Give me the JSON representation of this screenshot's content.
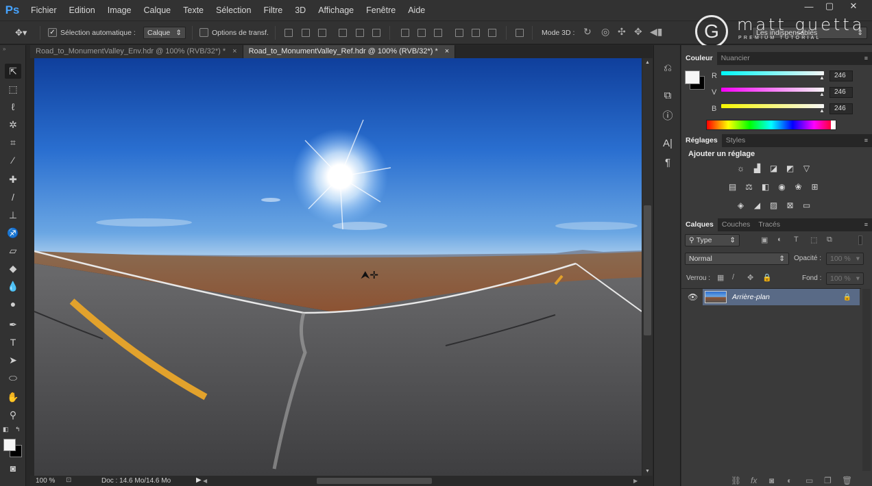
{
  "app_logo": "Ps",
  "menu": [
    "Fichier",
    "Edition",
    "Image",
    "Calque",
    "Texte",
    "Sélection",
    "Filtre",
    "3D",
    "Affichage",
    "Fenêtre",
    "Aide"
  ],
  "window_controls": {
    "minimize": "—",
    "restore": "▢",
    "close": "✕"
  },
  "watermark": {
    "title": "matt guetta",
    "subtitle": "PREMIUM TUTORIAL"
  },
  "options": {
    "auto_select_label": "Sélection automatique :",
    "auto_select_checked": true,
    "auto_select_value": "Calque",
    "transform_label": "Options de transf.",
    "mode3d_label": "Mode 3D :",
    "workspace": "Les indispensables"
  },
  "tabs": [
    {
      "label": "Road_to_MonumentValley_Env.hdr @ 100% (RVB/32*) *",
      "close": "×"
    },
    {
      "label": "Road_to_MonumentValley_Ref.hdr @ 100% (RVB/32*) *",
      "close": "×"
    }
  ],
  "status": {
    "zoom": "100 %",
    "doc": "Doc : 14.6 Mo/14.6 Mo"
  },
  "color_panel": {
    "tabs": [
      "Couleur",
      "Nuancier"
    ],
    "channels": [
      {
        "label": "R",
        "value": "246"
      },
      {
        "label": "V",
        "value": "246"
      },
      {
        "label": "B",
        "value": "246"
      }
    ]
  },
  "adjust_panel": {
    "tabs": [
      "Réglages",
      "Styles"
    ],
    "heading": "Ajouter un réglage"
  },
  "layers_panel": {
    "tabs": [
      "Calques",
      "Couches",
      "Tracés"
    ],
    "filter": "Type",
    "blend_mode": "Normal",
    "opacity_label": "Opacité :",
    "opacity_value": "100 %",
    "lock_label": "Verrou :",
    "fill_label": "Fond :",
    "fill_value": "100 %",
    "layer_name": "Arrière-plan"
  }
}
